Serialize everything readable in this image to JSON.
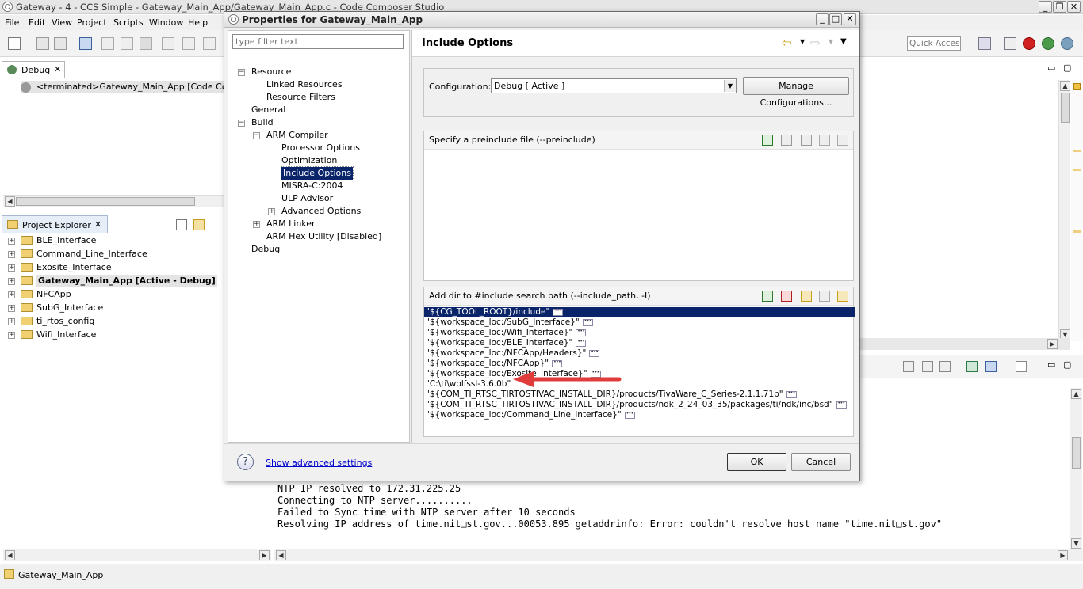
{
  "window": {
    "title": "Gateway - 4 - CCS Simple - Gateway_Main_App/Gateway_Main_App.c - Code Composer Studio"
  },
  "menu": [
    "File",
    "Edit",
    "View",
    "Project",
    "Scripts",
    "Window",
    "Help"
  ],
  "quick_access": {
    "placeholder": "Quick Access"
  },
  "debug_view": {
    "tab_label": "Debug",
    "item": "<terminated>Gateway_Main_App [Code Compos"
  },
  "project_explorer": {
    "tab_label": "Project Explorer",
    "projects": [
      {
        "label": "BLE_Interface"
      },
      {
        "label": "Command_Line_Interface"
      },
      {
        "label": "Exosite_Interface"
      },
      {
        "label": "Gateway_Main_App  [Active - Debug]",
        "bold": true
      },
      {
        "label": "NFCApp"
      },
      {
        "label": "SubG_Interface"
      },
      {
        "label": "ti_rtos_config"
      },
      {
        "label": "Wifi_Interface"
      }
    ]
  },
  "console": {
    "lines": [
      "NTP IP resolved to 172.31.225.25",
      "Connecting to NTP server..........",
      "Failed to Sync time with NTP server after 10 seconds",
      "Resolving IP address of time.nit⁠□st.gov...00053.895 getaddrinfo: Error: couldn't resolve host name \"time.nit□st.gov\""
    ]
  },
  "status_bar": {
    "label": "Gateway_Main_App"
  },
  "dialog": {
    "title": "Properties for Gateway_Main_App",
    "filter_placeholder": "type filter text",
    "tree": [
      {
        "label": "Resource",
        "depth": 0,
        "exp": "-"
      },
      {
        "label": "Linked Resources",
        "depth": 1,
        "exp": ""
      },
      {
        "label": "Resource Filters",
        "depth": 1,
        "exp": ""
      },
      {
        "label": "General",
        "depth": 0,
        "exp": ""
      },
      {
        "label": "Build",
        "depth": 0,
        "exp": "-"
      },
      {
        "label": "ARM Compiler",
        "depth": 1,
        "exp": "-"
      },
      {
        "label": "Processor Options",
        "depth": 2,
        "exp": ""
      },
      {
        "label": "Optimization",
        "depth": 2,
        "exp": ""
      },
      {
        "label": "Include Options",
        "depth": 2,
        "exp": "",
        "selected": true
      },
      {
        "label": "MISRA-C:2004",
        "depth": 2,
        "exp": ""
      },
      {
        "label": "ULP Advisor",
        "depth": 2,
        "exp": ""
      },
      {
        "label": "Advanced Options",
        "depth": 2,
        "exp": "+"
      },
      {
        "label": "ARM Linker",
        "depth": 1,
        "exp": "+"
      },
      {
        "label": "ARM Hex Utility  [Disabled]",
        "depth": 1,
        "exp": ""
      },
      {
        "label": "Debug",
        "depth": 0,
        "exp": ""
      }
    ],
    "page_title": "Include Options",
    "configuration": {
      "label": "Configuration:",
      "value": "Debug  [ Active ]",
      "manage_button": "Manage Configurations..."
    },
    "preinclude": {
      "title": "Specify a preinclude file (--preinclude)"
    },
    "include_path": {
      "title": "Add dir to #include search path (--include_path, -I)",
      "items": [
        {
          "text": "\"${CG_TOOL_ROOT}/include\"",
          "selected": true
        },
        {
          "text": "\"${workspace_loc:/SubG_Interface}\""
        },
        {
          "text": "\"${workspace_loc:/Wifi_Interface}\""
        },
        {
          "text": "\"${workspace_loc:/BLE_Interface}\""
        },
        {
          "text": "\"${workspace_loc:/NFCApp/Headers}\""
        },
        {
          "text": "\"${workspace_loc:/NFCApp}\""
        },
        {
          "text": "\"${workspace_loc:/Exosite_Interface}\""
        },
        {
          "text": "\"C:\\ti\\wolfssl-3.6.0b\"",
          "no_dots": true
        },
        {
          "text": "\"${COM_TI_RTSC_TIRTOSTIVAC_INSTALL_DIR}/products/TivaWare_C_Series-2.1.1.71b\""
        },
        {
          "text": "\"${COM_TI_RTSC_TIRTOSTIVAC_INSTALL_DIR}/products/ndk_2_24_03_35/packages/ti/ndk/inc/bsd\""
        },
        {
          "text": "\"${workspace_loc:/Command_Line_Interface}\""
        }
      ]
    },
    "advanced_link": "Show advanced settings",
    "ok_button": "OK",
    "cancel_button": "Cancel"
  },
  "colors": {
    "selection": "#0a246a",
    "arrow": "#e03c3c",
    "link": "#0000cc",
    "title_bar": "#ececec",
    "dialog_bg": "#f0f0f0"
  }
}
